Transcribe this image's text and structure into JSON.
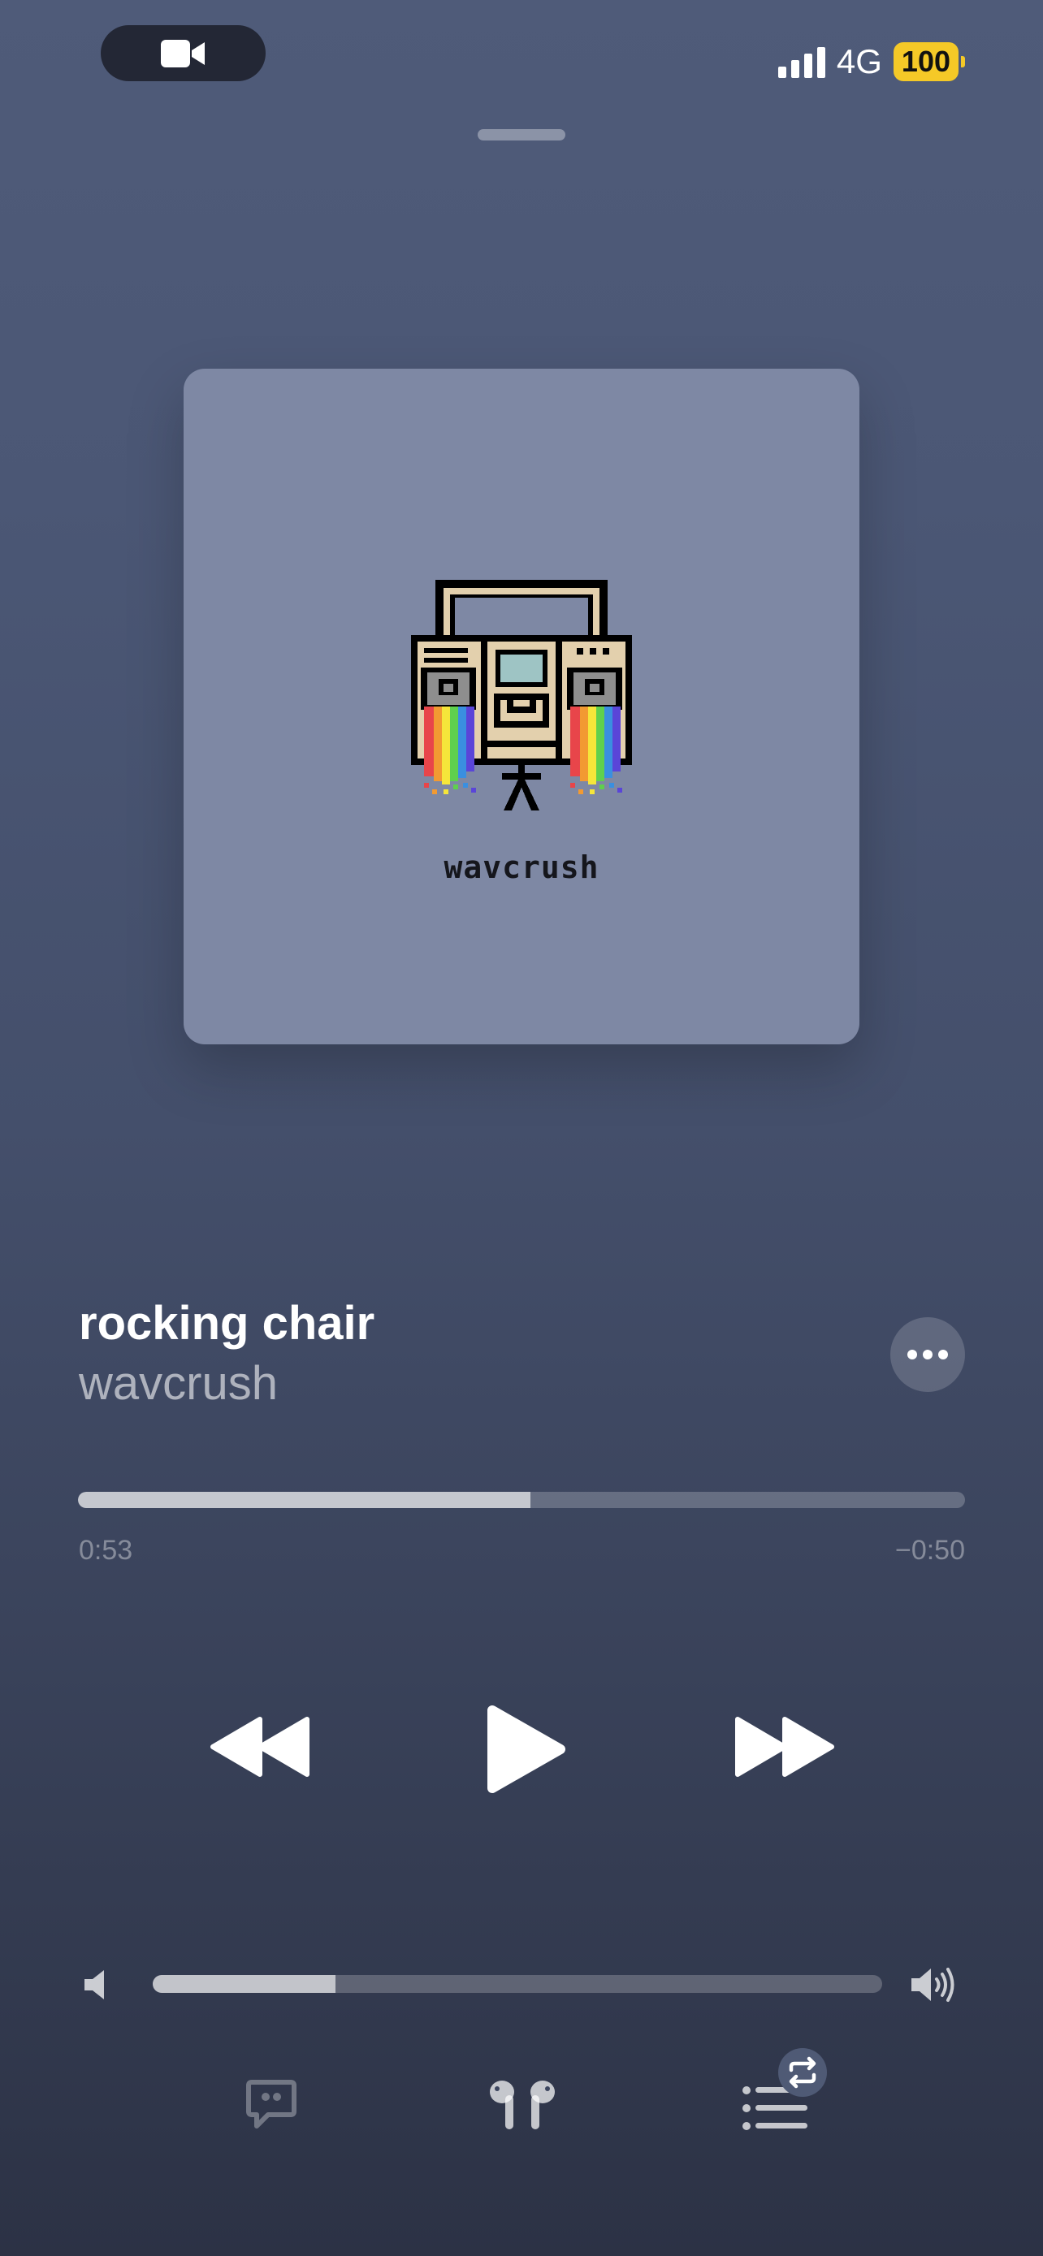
{
  "status_bar": {
    "network": "4G",
    "battery": "100",
    "signal_bars": 4
  },
  "artwork": {
    "label": "wavcrush"
  },
  "track": {
    "title": "rocking chair",
    "artist": "wavcrush"
  },
  "playback": {
    "elapsed": "0:53",
    "remaining": "−0:50",
    "progress_fraction": 0.51
  },
  "volume": {
    "level_fraction": 0.25
  },
  "icons": {
    "camera": "video-camera-icon",
    "more": "ellipsis-icon",
    "rewind": "rewind-icon",
    "play": "play-icon",
    "forward": "fast-forward-icon",
    "volume_low": "speaker-low-icon",
    "volume_high": "speaker-high-icon",
    "lyrics": "quote-bubble-icon",
    "airplay": "airpods-icon",
    "queue": "queue-list-icon",
    "repeat": "repeat-icon"
  },
  "colors": {
    "battery": "#f5c927",
    "artwork_background": "#7e88a4"
  }
}
